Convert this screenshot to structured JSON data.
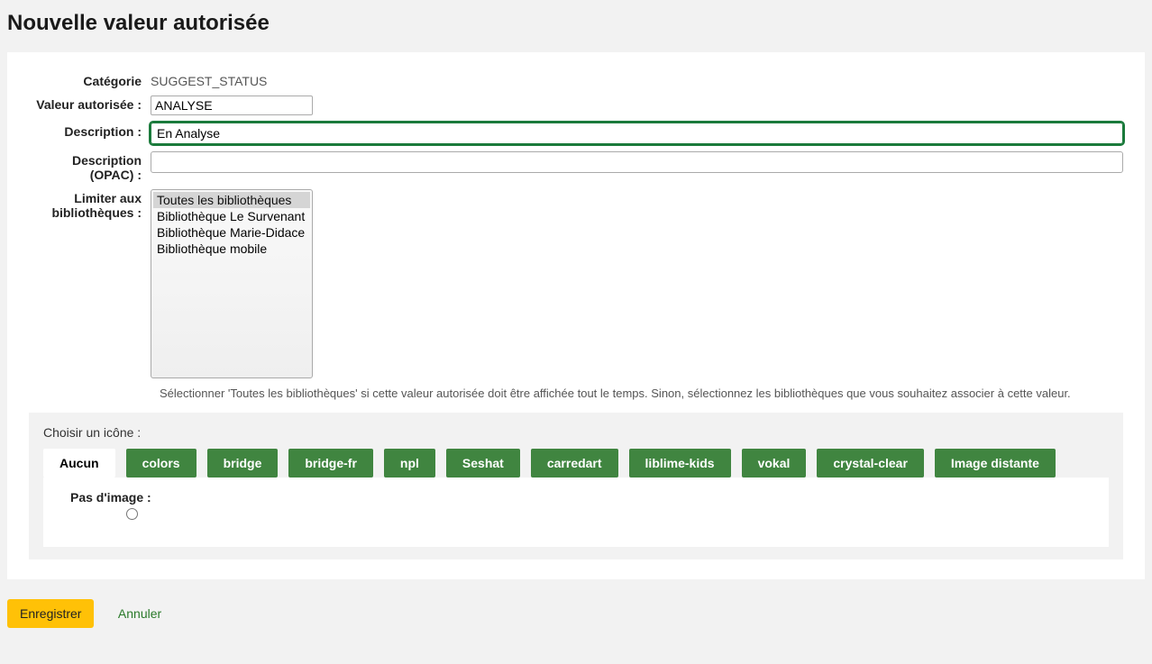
{
  "title": "Nouvelle valeur autorisée",
  "form": {
    "category_label": "Catégorie",
    "category_value": "SUGGEST_STATUS",
    "authval_label": "Valeur autorisée :",
    "authval_value": "ANALYSE",
    "description_label": "Description :",
    "description_value": "En Analyse",
    "description_opac_label": "Description (OPAC) :",
    "description_opac_value": "",
    "limit_libs_label": "Limiter aux bibliothèques :",
    "libs": [
      "Toutes les bibliothèques",
      "Bibliothèque Le Survenant",
      "Bibliothèque Marie-Didace",
      "Bibliothèque mobile"
    ],
    "libs_help": "Sélectionner 'Toutes les bibliothèques' si cette valeur autorisée doit être affichée tout le temps. Sinon, sélectionnez les bibliothèques que vous souhaitez associer à cette valeur."
  },
  "icons": {
    "fieldset_label": "Choisir un icône :",
    "tabs": [
      "Aucun",
      "colors",
      "bridge",
      "bridge-fr",
      "npl",
      "Seshat",
      "carredart",
      "liblime-kids",
      "vokal",
      "crystal-clear",
      "Image distante"
    ],
    "active_tab": 0,
    "noimage_label": "Pas d'image :"
  },
  "actions": {
    "save": "Enregistrer",
    "cancel": "Annuler"
  }
}
